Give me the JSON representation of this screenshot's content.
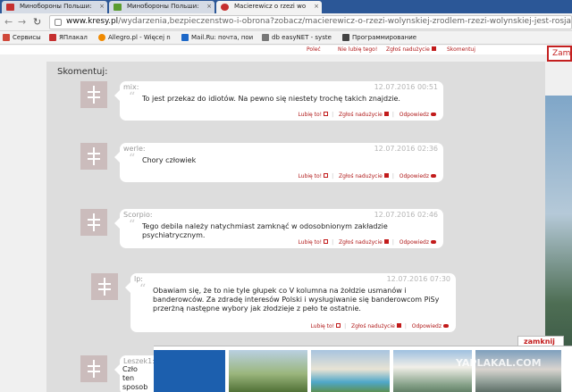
{
  "browser": {
    "tabs": [
      {
        "label": "Минобороны Польши: ",
        "fav_color": "#c52f2f"
      },
      {
        "label": "Минобороны Польши: ",
        "fav_color": "#5a9c2f"
      },
      {
        "label": "Macierewicz o rzezi wo",
        "fav_color": "#c52f2f"
      }
    ],
    "url_host": "www.kresy.pl",
    "url_path": "/wydarzenia,bezpieczenstwo-i-obrona?zobacz/macierewicz-o-rzezi-wolynskiej-zrodlem-rzezi-wolynskiej-jest-rosja-vide",
    "bookmarks": [
      {
        "label": "Сервисы",
        "color": "#d0483a"
      },
      {
        "label": "ЯПлакал",
        "color": "#c52f2f"
      },
      {
        "label": "Allegro.pl - Więcej n",
        "color": "#f08a00"
      },
      {
        "label": "Mail.Ru: почта, пои",
        "color": "#1d68c8"
      },
      {
        "label": "db easyNET - syste",
        "color": "#777777"
      },
      {
        "label": "Программирование",
        "color": "#444444"
      }
    ]
  },
  "page": {
    "top_links": [
      "Poleć",
      "Nie lubię tego!",
      "Zgłoś nadużycie",
      "Skomentuj"
    ],
    "zam_label": "Zam",
    "section_title": "Skomentuj:",
    "comments": [
      {
        "author": "mix:",
        "date": "12.07.2016 00:51",
        "text": "To jest przekaz do idiotów. Na pewno się niestety trochę takich znajdzie."
      },
      {
        "author": "werle:",
        "date": "12.07.2016 02:36",
        "text": "Chory człowiek"
      },
      {
        "author": "Scorpio:",
        "date": "12.07.2016 02:46",
        "text": "Tego debila należy natychmiast zamknąć w odosobnionym zakładzie psychiatrycznym."
      },
      {
        "author": "lp:",
        "date": "12.07.2016 07:30",
        "text": "Obawiam się, że to nie tyle głupek co V kolumna na żołdzie usmanów i banderowców. Za zdradę interesów Polski i wysługiwanie się banderowcom PiSy przerżną następne wybory jak złodzieje z peło te ostatnie."
      },
      {
        "author": "Leszek1:",
        "date": "",
        "text": "Czło ten sposob przygotow"
      }
    ],
    "actions": {
      "like": "Lubię to!",
      "report": "Zgłoś nadużycie",
      "reply": "Odpowiedz"
    }
  },
  "ad": {
    "close_label": "zamknij",
    "watermark": "YAPLAKAL.COM"
  }
}
